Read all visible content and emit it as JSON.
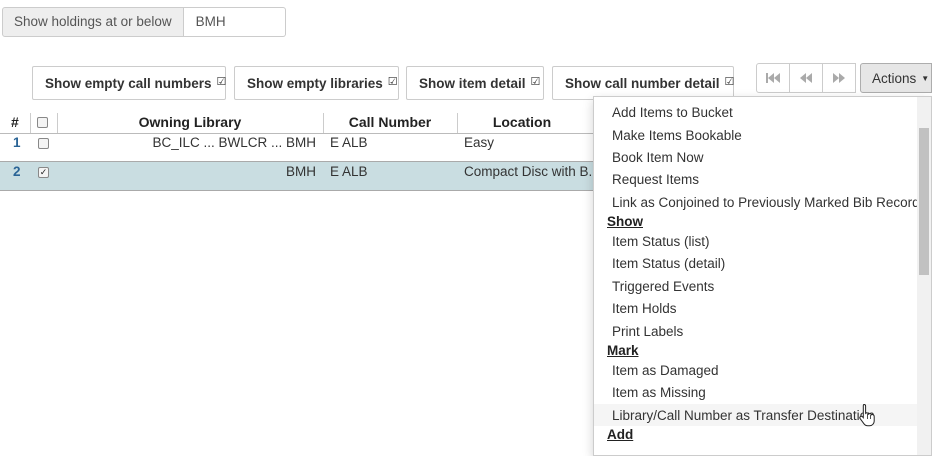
{
  "holdings_filter": {
    "label": "Show holdings at or below",
    "value": "BMH"
  },
  "toggles": [
    {
      "label": "Show empty call numbers",
      "checked": true
    },
    {
      "label": "Show empty libraries",
      "checked": true
    },
    {
      "label": "Show item detail",
      "checked": true
    },
    {
      "label": "Show call number detail",
      "checked": true
    }
  ],
  "pager": {
    "first_icon": "first-page-icon",
    "prev_icon": "previous-page-icon",
    "next_icon": "next-page-icon"
  },
  "actions": {
    "label": "Actions",
    "menu": {
      "items_top": [
        "Add Items to Bucket",
        "Make Items Bookable",
        "Book Item Now",
        "Request Items",
        "Link as Conjoined to Previously Marked Bib Record"
      ],
      "show_header": "Show",
      "show_items": [
        "Item Status (list)",
        "Item Status (detail)",
        "Triggered Events",
        "Item Holds",
        "Print Labels"
      ],
      "mark_header": "Mark",
      "mark_items": [
        "Item as Damaged",
        "Item as Missing",
        "Library/Call Number as Transfer Destination"
      ],
      "add_header": "Add"
    }
  },
  "grid": {
    "columns": {
      "num": "#",
      "owning_library": "Owning Library",
      "call_number": "Call Number",
      "location": "Location"
    },
    "rows": [
      {
        "num": "1",
        "selected": false,
        "owning_library": "BC_ILC ... BWLCR ... BMH",
        "call_number": "E ALB",
        "location": "Easy"
      },
      {
        "num": "2",
        "selected": true,
        "owning_library": "BMH",
        "call_number": "E ALB",
        "location": "Compact Disc with B..."
      }
    ]
  },
  "colors": {
    "selected_row": "#c9dde1",
    "row_number": "#2a6496",
    "actions_button": "#e6e6e6"
  }
}
